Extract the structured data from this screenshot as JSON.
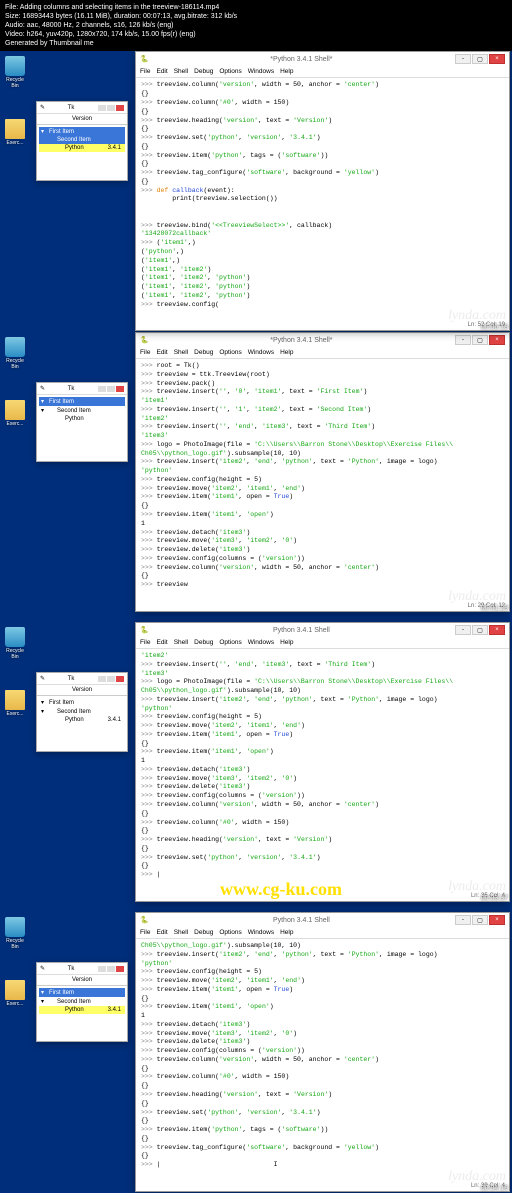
{
  "meta": {
    "file": "File: Adding columns and selecting items in the treeview-186114.mp4",
    "size": "Size: 16893443 bytes (16.11 MiB), duration: 00:07:13, avg.bitrate: 312 kb/s",
    "audio": "Audio: aac, 48000 Hz, 2 channels, s16, 126 kb/s (eng)",
    "video": "Video: h264, yuv420p, 1280x720, 174 kb/s, 15.00 fps(r) (eng)",
    "gen": "Generated by Thumbnail me"
  },
  "icons": {
    "recycle": "Recycle Bin",
    "folder_label": "Exerc..."
  },
  "tk": {
    "title": "Tk"
  },
  "tree1": {
    "rows": [
      {
        "twist": "▾",
        "sel": true,
        "label": "First Item"
      },
      {
        "twist": "▾",
        "indent": 6,
        "label": "Second Item"
      },
      {
        "twist": "",
        "indent": 14,
        "label": "Python"
      }
    ]
  },
  "tree2": {
    "heading": "Version",
    "rows": [
      {
        "twist": "▾",
        "label": "First Item",
        "ver": ""
      },
      {
        "twist": "▾",
        "indent": 6,
        "label": "Second Item",
        "ver": ""
      },
      {
        "twist": "",
        "indent": 14,
        "label": "Python",
        "ver": "3.4.1"
      }
    ]
  },
  "tree3": {
    "heading": "Version",
    "rows": [
      {
        "twist": "▾",
        "sel": true,
        "label": "First Item",
        "ver": ""
      },
      {
        "twist": "▾",
        "indent": 6,
        "label": "Second Item",
        "ver": ""
      },
      {
        "twist": "",
        "indent": 14,
        "yellow": true,
        "label": "Python",
        "ver": "3.4.1"
      }
    ]
  },
  "tree4": {
    "heading": "Version",
    "rows": [
      {
        "twist": "▾",
        "sel": true,
        "label": "First Item",
        "ver": ""
      },
      {
        "twist": "",
        "indent": 6,
        "sel": true,
        "label": "Second Item",
        "ver": ""
      },
      {
        "twist": "",
        "indent": 14,
        "yellow": true,
        "label": "Python",
        "ver": "3.4.1"
      }
    ]
  },
  "menu": [
    "File",
    "Edit",
    "Shell",
    "Debug",
    "Options",
    "Windows",
    "Help"
  ],
  "shell_title_1": "*Python 3.4.1 Shell*",
  "shell_title_2": "Python 3.4.1 Shell",
  "status1": "Ln: 29 Col: 12",
  "status2": "Ln: 35 Col: 4",
  "status3": "Ln: 39 Col: 4",
  "status4": "Ln: 52 Col: 19",
  "time1": "00:01:29",
  "time2": "00:03:37",
  "time3": "00:04:19",
  "time4": "00:06:18",
  "url": "www.cg-ku.com",
  "wm": "lynda.com"
}
